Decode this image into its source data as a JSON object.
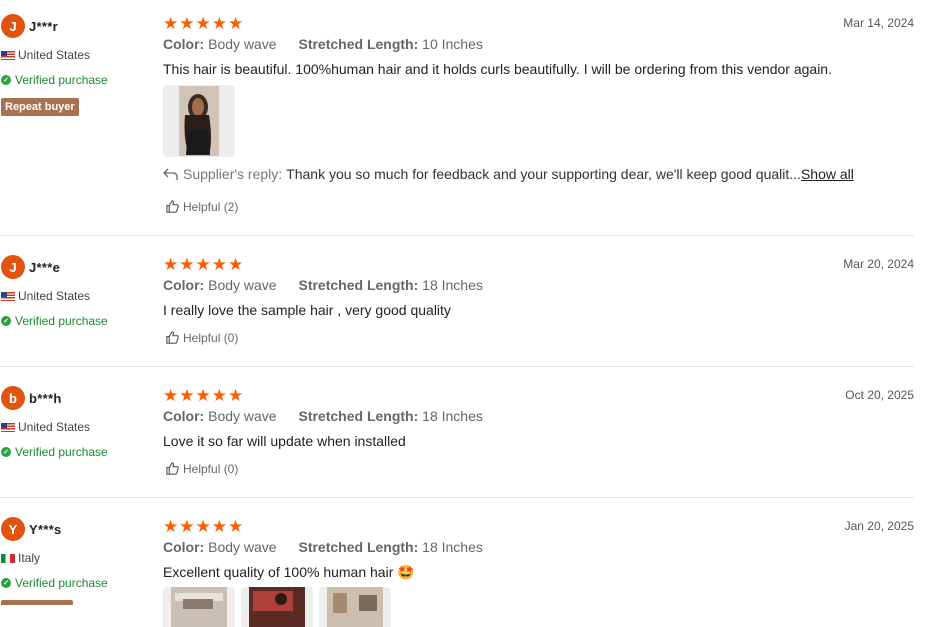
{
  "reviews": [
    {
      "avatar_letter": "J",
      "name": "J***r",
      "country": "United States",
      "verified": "Verified purchase",
      "badge": "Repeat buyer",
      "stars": "★★★★★",
      "date": "Mar 14, 2024",
      "color_key": "Color:",
      "color_val": "Body wave",
      "length_key": "Stretched Length:",
      "length_val": "10 Inches",
      "text": "This hair is beautiful. 100%human hair and it holds curls beautifully. I will be ordering from this vendor again.",
      "reply_label": "Supplier's reply:",
      "reply_text": "Thank you so much for feedback and your supporting dear, we'll keep good qualit",
      "reply_ellipsis": "...",
      "show_all": "Show all",
      "helpful": "Helpful (2)"
    },
    {
      "avatar_letter": "J",
      "name": "J***e",
      "country": "United States",
      "verified": "Verified purchase",
      "stars": "★★★★★",
      "date": "Mar 20, 2024",
      "color_key": "Color:",
      "color_val": "Body wave",
      "length_key": "Stretched Length:",
      "length_val": "18 Inches",
      "text": "I really love the sample hair , very good quality",
      "helpful": "Helpful (0)"
    },
    {
      "avatar_letter": "b",
      "name": "b***h",
      "country": "United States",
      "verified": "Verified purchase",
      "stars": "★★★★★",
      "date": "Oct 20, 2025",
      "color_key": "Color:",
      "color_val": "Body wave",
      "length_key": "Stretched Length:",
      "length_val": "18 Inches",
      "text": "Love it so far will update when installed",
      "helpful": "Helpful (0)"
    },
    {
      "avatar_letter": "Y",
      "name": "Y***s",
      "country": "Italy",
      "verified": "Verified purchase",
      "stars": "★★★★★",
      "date": "Jan 20, 2025",
      "color_key": "Color:",
      "color_val": "Body wave",
      "length_key": "Stretched Length:",
      "length_val": "18 Inches",
      "text": "Excellent quality of 100% human hair",
      "emoji": "🤩"
    }
  ],
  "colors": {
    "accent": "#ff5c00",
    "avatar": "#e0540f",
    "verified": "#1a8a2e",
    "badge": "#a8724f"
  }
}
